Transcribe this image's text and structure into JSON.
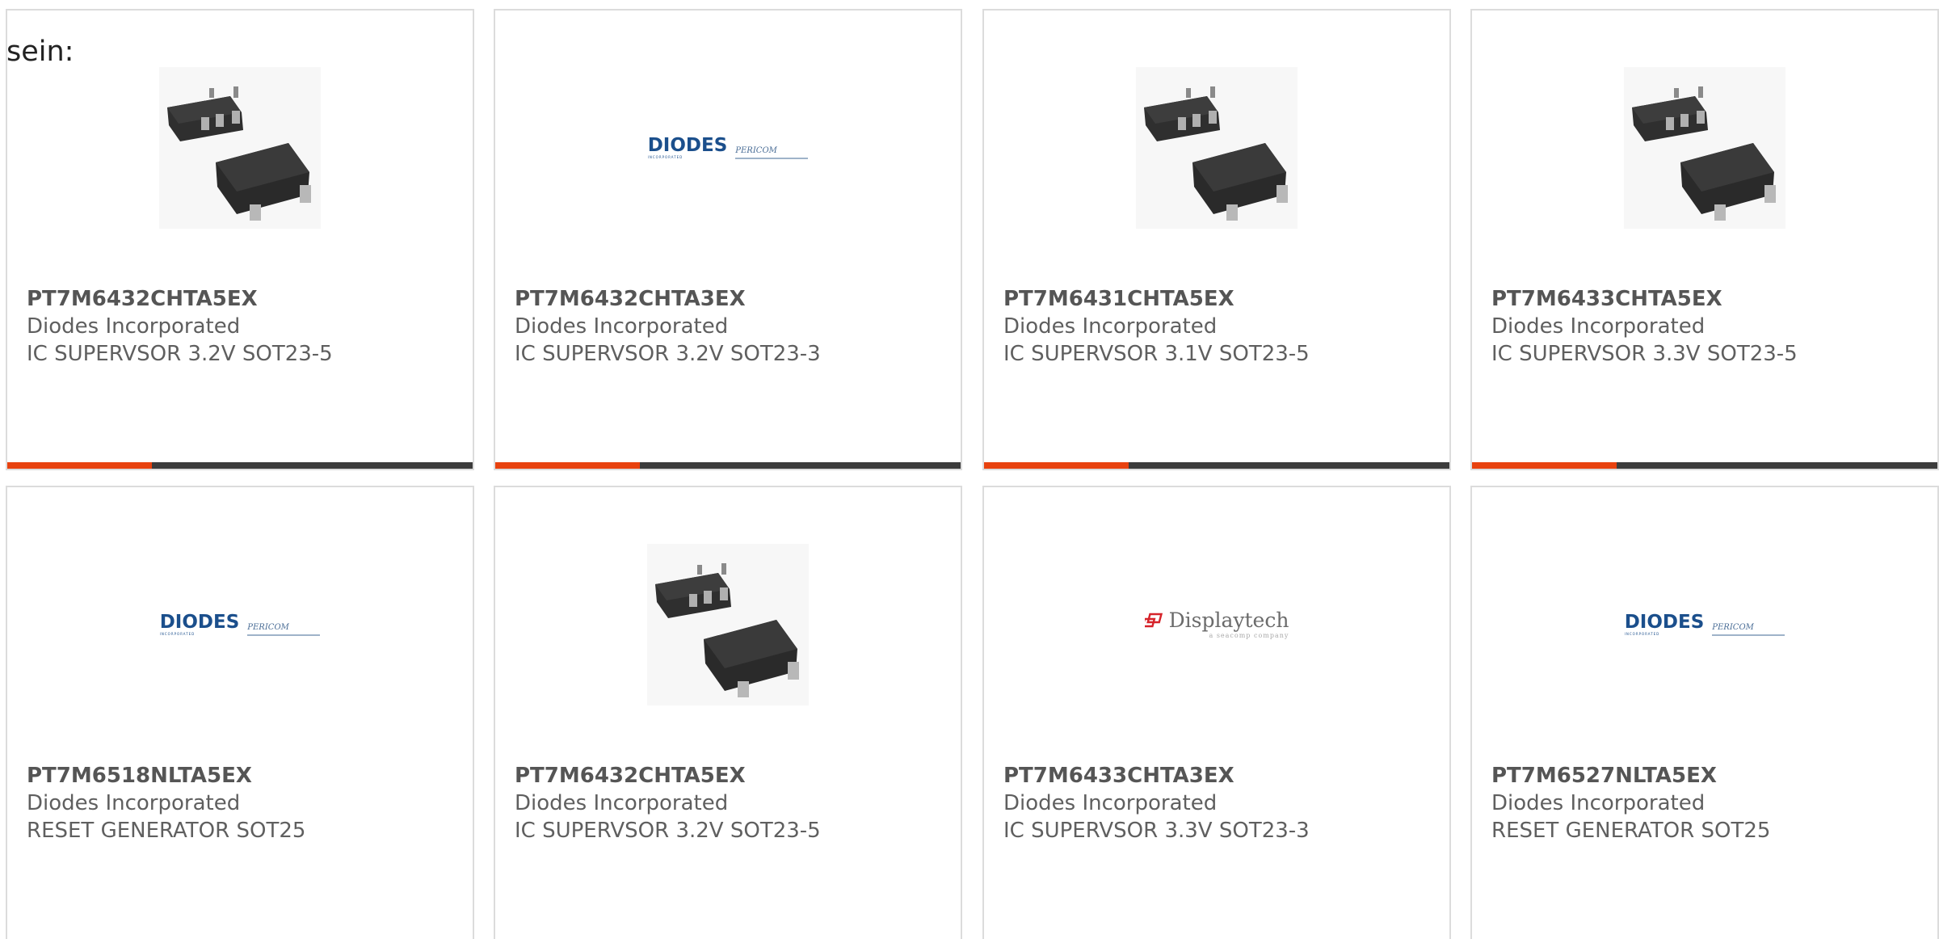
{
  "intro_text": "sein:",
  "colors": {
    "accent_progress": "#e8420f",
    "progress_track": "#3c3c3c",
    "card_border": "#dcdcdc",
    "text": "#5f5f5f",
    "diodes_brand": "#1b4f8c",
    "displaytech_brand": "#d6232a"
  },
  "cards": [
    {
      "part_number": "PT7M6432CHTA5EX",
      "manufacturer": "Diodes Incorporated",
      "description": "IC SUPERVSOR 3.2V SOT23-5",
      "image_type": "chip",
      "progress": 0.31
    },
    {
      "part_number": "PT7M6432CHTA3EX",
      "manufacturer": "Diodes Incorporated",
      "description": "IC SUPERVSOR 3.2V SOT23-3",
      "image_type": "diodes-logo",
      "logo_text": "DIODES",
      "logo_subtext": "INCORPORATED",
      "logo_secondary": "PERICOM",
      "progress": 0.31
    },
    {
      "part_number": "PT7M6431CHTA5EX",
      "manufacturer": "Diodes Incorporated",
      "description": "IC SUPERVSOR 3.1V SOT23-5",
      "image_type": "chip",
      "progress": 0.31
    },
    {
      "part_number": "PT7M6433CHTA5EX",
      "manufacturer": "Diodes Incorporated",
      "description": "IC SUPERVSOR 3.3V SOT23-5",
      "image_type": "chip",
      "progress": 0.31
    },
    {
      "part_number": "PT7M6518NLTA5EX",
      "manufacturer": "Diodes Incorporated",
      "description": "RESET GENERATOR SOT25",
      "image_type": "diodes-logo",
      "logo_text": "DIODES",
      "logo_subtext": "INCORPORATED",
      "logo_secondary": "PERICOM"
    },
    {
      "part_number": "PT7M6432CHTA5EX",
      "manufacturer": "Diodes Incorporated",
      "description": "IC SUPERVSOR 3.2V SOT23-5",
      "image_type": "chip"
    },
    {
      "part_number": "PT7M6433CHTA3EX",
      "manufacturer": "Diodes Incorporated",
      "description": "IC SUPERVSOR 3.3V SOT23-3",
      "image_type": "displaytech-logo",
      "logo_text": "Displaytech",
      "logo_subtext": "a seacomp company"
    },
    {
      "part_number": "PT7M6527NLTA5EX",
      "manufacturer": "Diodes Incorporated",
      "description": "RESET GENERATOR SOT25",
      "image_type": "diodes-logo",
      "logo_text": "DIODES",
      "logo_subtext": "INCORPORATED",
      "logo_secondary": "PERICOM"
    }
  ]
}
